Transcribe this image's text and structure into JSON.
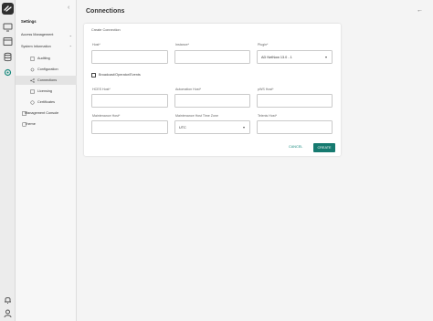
{
  "page": {
    "title": "Connections"
  },
  "sidebar": {
    "title": "Settings",
    "items": [
      {
        "label": "Access Management"
      },
      {
        "label": "System Information"
      },
      {
        "label": "Auditing"
      },
      {
        "label": "Configuration"
      },
      {
        "label": "Connections"
      },
      {
        "label": "Licensing"
      },
      {
        "label": "Certificates"
      },
      {
        "label": "Management Console"
      },
      {
        "label": "Theme"
      }
    ]
  },
  "form": {
    "title": "Create Connection",
    "fields": [
      {
        "label": "Host*",
        "value": ""
      },
      {
        "label": "Instance*",
        "value": ""
      },
      {
        "label": "Plugin*",
        "value": "AD NetNow 13.0 - 1"
      },
      {
        "label": "HCES Host*",
        "value": ""
      },
      {
        "label": "Automation Host*",
        "value": ""
      },
      {
        "label": "pWS Host*",
        "value": ""
      },
      {
        "label": "Maintenance Host*",
        "value": ""
      },
      {
        "label": "Maintenance Host Time Zone",
        "value": "UTC"
      },
      {
        "label": "Telenis Host*",
        "value": ""
      }
    ],
    "checkbox_label": "Broadcast/Operator/Events",
    "cancel_label": "CANCEL",
    "create_label": "CREATE"
  },
  "colors": {
    "accent": "#167a70",
    "link": "#178a7e"
  }
}
